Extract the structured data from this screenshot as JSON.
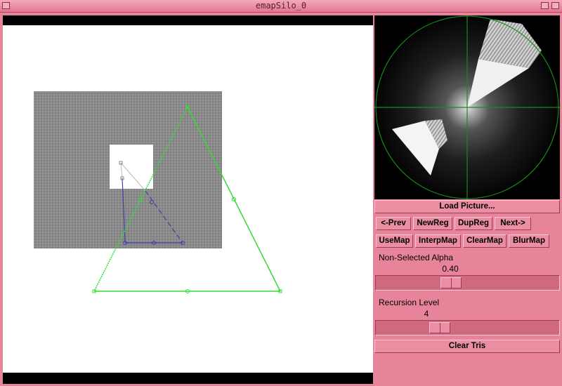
{
  "window": {
    "title": "emapSilo_0"
  },
  "buttons": {
    "load_picture": "Load Picture...",
    "prev": "<-Prev",
    "new_reg": "NewReg",
    "dup_reg": "DupReg",
    "next": "Next->",
    "use_map": "UseMap",
    "interp_map": "InterpMap",
    "clear_map": "ClearMap",
    "blur_map": "BlurMap",
    "clear_tris": "Clear Tris"
  },
  "sliders": {
    "alpha": {
      "label": "Non-Selected Alpha",
      "value": "0.40",
      "fraction": 0.4
    },
    "recursion": {
      "label": "Recursion Level",
      "value": "4",
      "fraction": 0.33
    }
  },
  "colors": {
    "background": "#e8849a",
    "selected_triangle": "#33dd33",
    "guide_lines": "#4040aa",
    "crosshair": "#1a8a1a"
  }
}
